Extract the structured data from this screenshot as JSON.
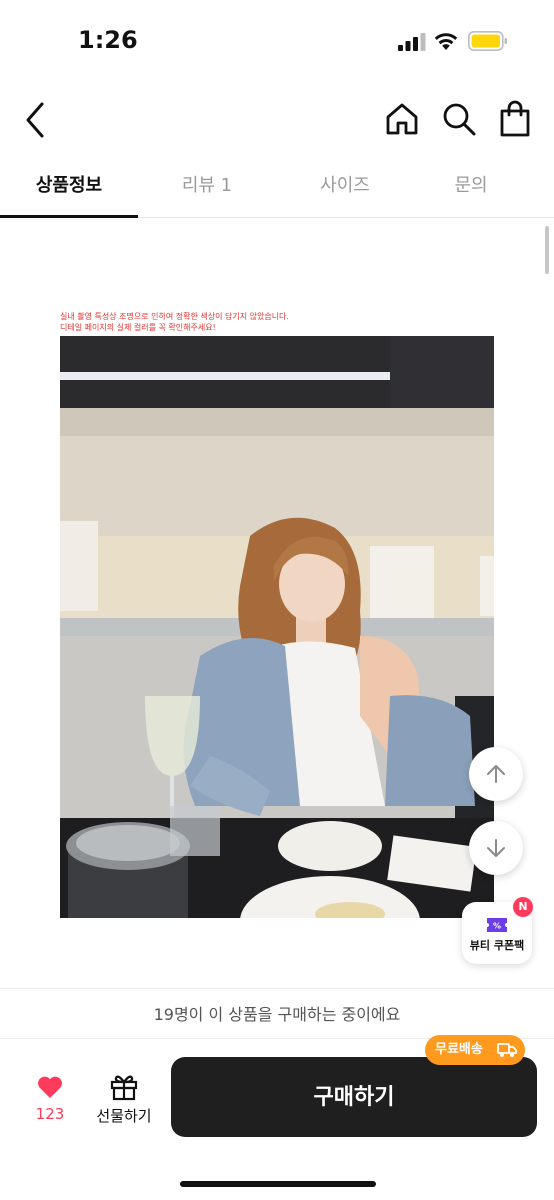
{
  "status_bar": {
    "time": "1:26",
    "signal_icon": "cellular-signal-icon",
    "wifi_icon": "wifi-icon",
    "battery_icon": "battery-icon",
    "battery_color": "#ffd60a"
  },
  "nav": {
    "back_icon": "chevron-left-icon",
    "home_icon": "home-icon",
    "search_icon": "search-icon",
    "bag_icon": "shopping-bag-icon"
  },
  "tabs": [
    {
      "label": "상품정보",
      "active": true
    },
    {
      "label": "리뷰 1",
      "active": false
    },
    {
      "label": "사이즈",
      "active": false
    },
    {
      "label": "문의",
      "active": false
    }
  ],
  "product": {
    "notice_line1": "실내 촬영 특성상 조명으로 인하여 정확한 색상이 담기지 않았습니다.",
    "notice_line2": "디테일 페이지의 실제 컬러를 꼭 확인해주세요!",
    "notice_color": "#e2332e"
  },
  "floating": {
    "scroll_up_icon": "arrow-up-icon",
    "scroll_down_icon": "arrow-down-icon",
    "coupon_label": "뷰티 쿠폰팩",
    "coupon_badge": "N",
    "coupon_icon": "coupon-ticket-icon"
  },
  "purchase_bar": {
    "buyers_text": "19명이 이 상품을 구매하는 중이에요",
    "like_count": "123",
    "like_icon": "heart-icon",
    "gift_label": "선물하기",
    "gift_icon": "gift-icon",
    "buy_label": "구매하기",
    "free_shipping_label": "무료배송",
    "free_shipping_icon": "truck-icon",
    "accent_color": "#ff9a1f",
    "like_color": "#ff3b5c"
  }
}
